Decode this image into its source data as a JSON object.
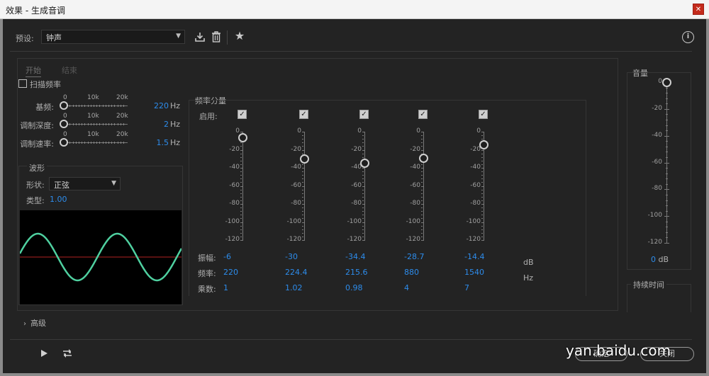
{
  "window": {
    "title": "效果 - 生成音调",
    "close_label": "✕"
  },
  "preset": {
    "label": "预设:",
    "value": "钟声"
  },
  "toolbar": {
    "save_icon": "download-save-icon",
    "delete_icon": "trash-icon",
    "favorite_icon": "star-icon",
    "info_icon": "info-icon"
  },
  "tabs": [
    {
      "label": "开始"
    },
    {
      "label": "结束"
    }
  ],
  "sweep": {
    "label": "扫描频率"
  },
  "sliders": [
    {
      "label": "基频:",
      "value": "220",
      "unit": "Hz",
      "level": 0.0
    },
    {
      "label": "调制深度:",
      "value": "2",
      "unit": "Hz",
      "level": 0.0
    },
    {
      "label": "调制速率:",
      "value": "1.5",
      "unit": "Hz",
      "level": 0.0
    }
  ],
  "slider_scale": [
    "0",
    "10k",
    "20k"
  ],
  "waveform": {
    "title": "波形",
    "shape_label": "形状:",
    "shape_value": "正弦",
    "type_label": "类型:",
    "type_value": "1.00",
    "colors": {
      "wave": "#4fd0a0",
      "axis": "#b22222",
      "bg": "#000000"
    }
  },
  "freq_components": {
    "title": "频率分量",
    "enable_label": "启用:",
    "scale": [
      "0",
      "-20",
      "-40",
      "-60",
      "-80",
      "-100",
      "-120"
    ],
    "amp_label": "振幅:",
    "freq_label": "频率:",
    "mult_label": "乘数:",
    "db_unit": "dB",
    "hz_unit": "Hz",
    "columns": [
      {
        "enabled": true,
        "amplitude": "-6",
        "frequency": "220",
        "multiplier": "1",
        "level": -6
      },
      {
        "enabled": true,
        "amplitude": "-30",
        "frequency": "224.4",
        "multiplier": "1.02",
        "level": -30
      },
      {
        "enabled": true,
        "amplitude": "-34.4",
        "frequency": "215.6",
        "multiplier": "0.98",
        "level": -34.4
      },
      {
        "enabled": true,
        "amplitude": "-28.7",
        "frequency": "880",
        "multiplier": "4",
        "level": -28.7
      },
      {
        "enabled": true,
        "amplitude": "-14.4",
        "frequency": "1540",
        "multiplier": "7",
        "level": -14.4
      }
    ]
  },
  "volume": {
    "title": "音量",
    "scale": [
      "0",
      "-20",
      "-40",
      "-60",
      "-80",
      "-100",
      "-120"
    ],
    "value": "0",
    "unit": "dB",
    "level": 0
  },
  "duration": {
    "title": "持续时间"
  },
  "advanced": {
    "label": "高级"
  },
  "footer": {
    "play_icon": "play-icon",
    "loop_icon": "loop-icon",
    "ok_label": "确定",
    "cancel_label": "关闭"
  },
  "watermark": "yan.baidu.com",
  "colors": {
    "accent": "#2d8ceb",
    "background": "#232323"
  }
}
